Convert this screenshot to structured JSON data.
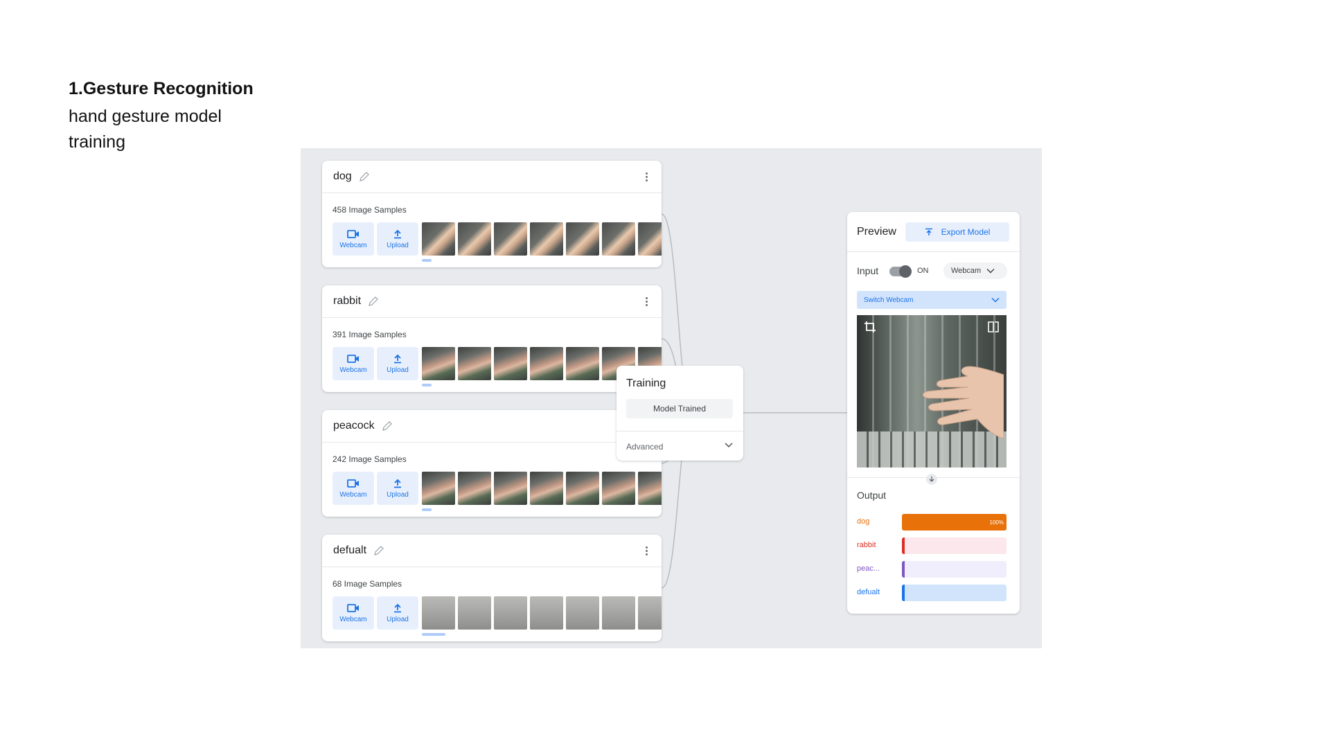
{
  "slide": {
    "title": "1.Gesture Recognition",
    "subtitle": "hand gesture model training"
  },
  "classes": [
    {
      "name": "dog",
      "samples": "458 Image Samples",
      "thumb_style": "hand"
    },
    {
      "name": "rabbit",
      "samples": "391 Image Samples",
      "thumb_style": "hand2"
    },
    {
      "name": "peacock",
      "samples": "242 Image Samples",
      "thumb_style": "hand2"
    },
    {
      "name": "defualt",
      "samples": "68 Image Samples",
      "thumb_style": "wall"
    }
  ],
  "source_buttons": {
    "webcam": "Webcam",
    "upload": "Upload"
  },
  "training": {
    "title": "Training",
    "button": "Model Trained",
    "advanced": "Advanced"
  },
  "preview": {
    "title": "Preview",
    "export": "Export Model",
    "input_label": "Input",
    "toggle_state": "ON",
    "input_source": "Webcam",
    "switch_webcam": "Switch Webcam",
    "output_label": "Output",
    "outputs": [
      {
        "name": "dog",
        "value": 1.0,
        "value_label": "100%",
        "color": "#e8710a",
        "track": "#fce8e6"
      },
      {
        "name": "rabbit",
        "value": 0.0,
        "value_label": "",
        "color": "#d93025",
        "track": "#fce8ec"
      },
      {
        "name": "peac...",
        "value": 0.0,
        "value_label": "",
        "color": "#7e57c2",
        "track": "#f0eefc"
      },
      {
        "name": "defualt",
        "value": 0.0,
        "value_label": "",
        "color": "#1a73e8",
        "track": "#d2e3fc"
      }
    ]
  },
  "icons": {
    "edit": "pencil-icon",
    "menu": "more-vert-icon",
    "webcam": "videocam-icon",
    "upload": "upload-icon",
    "export": "export-icon",
    "chevron": "chevron-down-icon",
    "crop": "crop-icon",
    "flip": "flip-icon",
    "arrow": "arrow-down-icon"
  }
}
